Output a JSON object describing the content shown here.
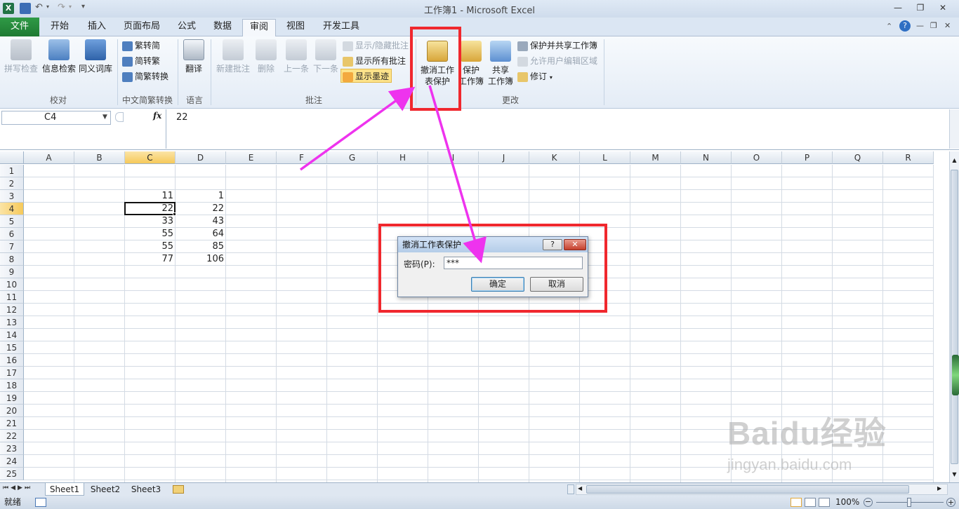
{
  "app": {
    "title": "工作簿1 - Microsoft Excel",
    "accent": "#217346"
  },
  "tabs": [
    "文件",
    "开始",
    "插入",
    "页面布局",
    "公式",
    "数据",
    "审阅",
    "视图",
    "开发工具"
  ],
  "active_tab": "审阅",
  "ribbon": {
    "groups": {
      "proofing": "校对",
      "chinese": "中文简繁转换",
      "language": "语言",
      "comments": "批注",
      "changes": "更改"
    },
    "proofing": {
      "spell": "拼写检查",
      "research": "信息检索",
      "thesaurus": "同义词库"
    },
    "chinese": {
      "to_simplified": "繁转简",
      "to_traditional": "简转繁",
      "convert": "简繁转换"
    },
    "language": {
      "translate": "翻译"
    },
    "comments": {
      "new": "新建批注",
      "delete": "删除",
      "prev": "上一条",
      "next": "下一条",
      "show_hide": "显示/隐藏批注",
      "show_all": "显示所有批注",
      "show_ink": "显示墨迹"
    },
    "changes": {
      "unprotect_line1": "撤消工作",
      "unprotect_line2": "表保护",
      "protect_wb_line1": "保护",
      "protect_wb_line2": "工作簿",
      "share_line1": "共享",
      "share_line2": "工作簿",
      "protect_share": "保护并共享工作簿",
      "allow_edit": "允许用户编辑区域",
      "track": "修订"
    }
  },
  "formula_bar": {
    "name_box": "C4",
    "fx": "fx",
    "formula": "22"
  },
  "grid": {
    "columns": [
      "A",
      "B",
      "C",
      "D",
      "E",
      "F",
      "G",
      "H",
      "I",
      "J",
      "K",
      "L",
      "M",
      "N",
      "O",
      "P",
      "Q",
      "R"
    ],
    "rows": [
      "1",
      "2",
      "3",
      "4",
      "5",
      "6",
      "7",
      "8",
      "9",
      "10",
      "11",
      "12",
      "13",
      "14",
      "15",
      "16",
      "17",
      "18",
      "19",
      "20",
      "21",
      "22",
      "23",
      "24",
      "25"
    ],
    "selected_col": "C",
    "selected_row": "4",
    "cells": {
      "C3": "11",
      "D3": "1",
      "C4": "22",
      "D4": "22",
      "C5": "33",
      "D5": "43",
      "C6": "55",
      "D6": "64",
      "C7": "55",
      "D7": "85",
      "C8": "77",
      "D8": "106"
    }
  },
  "sheets": [
    "Sheet1",
    "Sheet2",
    "Sheet3"
  ],
  "status": {
    "ready": "就绪",
    "zoom": "100%"
  },
  "dialog": {
    "title": "撤消工作表保护",
    "help": "?",
    "label": "密码(P):",
    "password": "***",
    "ok": "确定",
    "cancel": "取消"
  },
  "annotation_color": "#f0282e",
  "arrow_color": "#ee33ee",
  "watermark": {
    "logo": "Baidu经验",
    "url": "jingyan.baidu.com"
  }
}
